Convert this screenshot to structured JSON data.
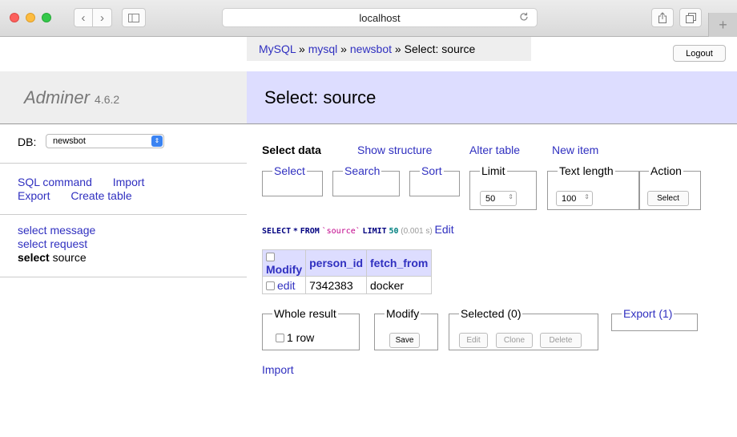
{
  "browser": {
    "url": "localhost",
    "back_glyph": "‹",
    "fwd_glyph": "›",
    "newtab_glyph": "+",
    "icons": [
      "back-icon",
      "forward-icon",
      "sidebar-icon",
      "reload-icon",
      "share-icon",
      "tabs-icon",
      "plus-icon"
    ]
  },
  "breadcrumb": {
    "items": [
      "MySQL",
      "mysql",
      "newsbot"
    ],
    "separator": " » ",
    "current": "Select: source"
  },
  "logout_label": "Logout",
  "brand": {
    "name": "Adminer",
    "version": "4.6.2"
  },
  "page_title": "Select: source",
  "db": {
    "label": "DB:",
    "selected": "newsbot"
  },
  "menu_links": [
    "SQL command",
    "Import",
    "Export",
    "Create table"
  ],
  "tables": [
    {
      "prefix": "select",
      "name": "message"
    },
    {
      "prefix": "select",
      "name": "request"
    },
    {
      "prefix": "select",
      "name": "source"
    }
  ],
  "tabs": [
    "Select data",
    "Show structure",
    "Alter table",
    "New item"
  ],
  "filters": {
    "select": "Select",
    "search": "Search",
    "sort": "Sort",
    "limit": {
      "label": "Limit",
      "value": "50"
    },
    "text_length": {
      "label": "Text length",
      "value": "100"
    },
    "action": {
      "label": "Action",
      "button": "Select"
    }
  },
  "query": {
    "select_kw": "SELECT",
    "star": "*",
    "from_kw": "FROM",
    "table": "`source`",
    "limit_kw": "LIMIT",
    "limit_val": "50",
    "time": "(0.001 s)",
    "edit": "Edit"
  },
  "grid": {
    "columns": [
      "Modify",
      "person_id",
      "fetch_from"
    ],
    "rows": [
      {
        "action": "edit",
        "person_id": "7342383",
        "fetch_from": "docker"
      }
    ]
  },
  "bottom": {
    "whole_result": {
      "label": "Whole result",
      "option": "1 row"
    },
    "modify": {
      "label": "Modify",
      "button": "Save"
    },
    "selected": {
      "label": "Selected (0)",
      "buttons": [
        "Edit",
        "Clone",
        "Delete"
      ]
    },
    "export": {
      "label": "Export (1)"
    }
  },
  "import_label": "Import",
  "colors": {
    "accent": "#3030c0",
    "header_bg": "#ddddff",
    "panel_bg": "#eeeeee"
  }
}
